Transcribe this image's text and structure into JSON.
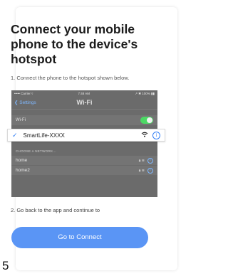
{
  "title": "Connect your mobile phone to the device's hotspot",
  "step1": "1. Connect the phone to the hotspot shown below.",
  "phone": {
    "status_left": "••••• Carrier ▿",
    "status_time": "7:48 AM",
    "status_right": "↗ ✱ 100% ▮▮",
    "back_label": "❮ Settings",
    "nav_title": "Wi-Fi",
    "wifi_label": "Wi-Fi",
    "selected_ssid": "SmartLife-XXXX",
    "section_header": "CHOOSE A NETWORK...",
    "networks": [
      {
        "name": "home"
      },
      {
        "name": "home2"
      }
    ]
  },
  "step2": "2. Go back to the app and continue to",
  "button_label": "Go to Connect",
  "page_number": "5",
  "colors": {
    "accent": "#5a95f5",
    "toggle_on": "#4cd964",
    "check": "#2f7df6"
  }
}
